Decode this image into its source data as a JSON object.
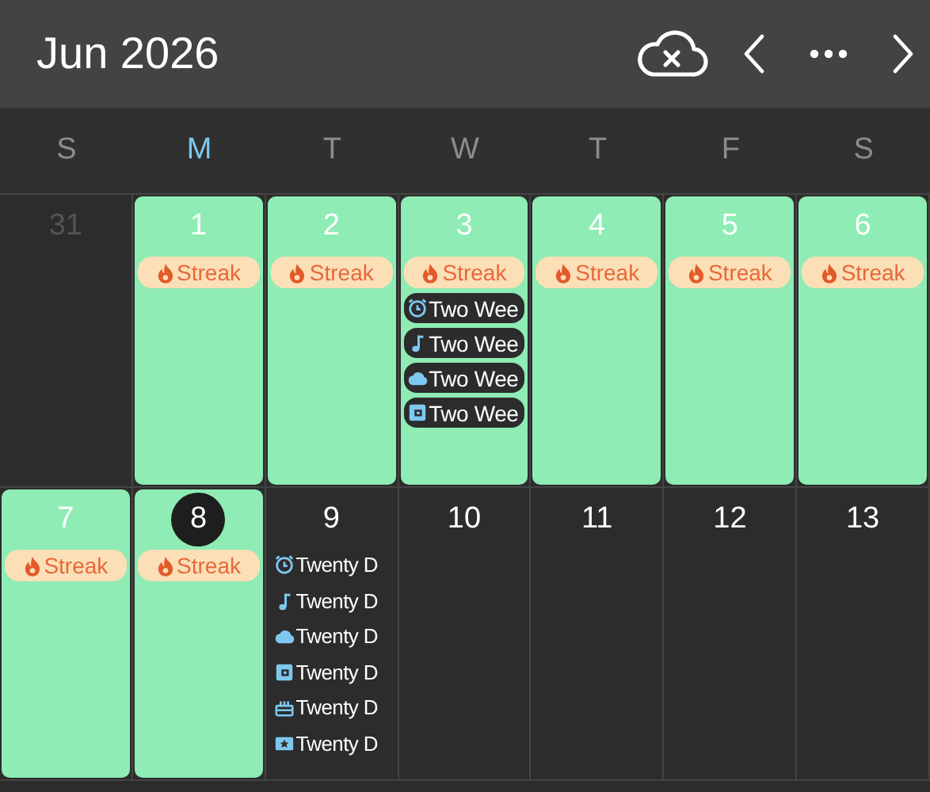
{
  "header": {
    "title": "Jun 2026"
  },
  "weekdays": [
    {
      "label": "S",
      "selected": false
    },
    {
      "label": "M",
      "selected": true
    },
    {
      "label": "T",
      "selected": false
    },
    {
      "label": "W",
      "selected": false
    },
    {
      "label": "T",
      "selected": false
    },
    {
      "label": "F",
      "selected": false
    },
    {
      "label": "S",
      "selected": false
    }
  ],
  "weeks": [
    {
      "days": [
        {
          "number": "31",
          "in_month": false,
          "streak": false,
          "today": false
        },
        {
          "number": "1",
          "in_month": true,
          "streak": true,
          "today": false,
          "events": [
            {
              "kind": "streak",
              "text": "Streak"
            }
          ]
        },
        {
          "number": "2",
          "in_month": true,
          "streak": true,
          "today": false,
          "events": [
            {
              "kind": "streak",
              "text": "Streak"
            }
          ]
        },
        {
          "number": "3",
          "in_month": true,
          "streak": true,
          "today": false,
          "events": [
            {
              "kind": "streak",
              "text": "Streak"
            },
            {
              "kind": "pill",
              "text": "Two Wee"
            },
            {
              "kind": "pill",
              "text": "Two Wee"
            },
            {
              "kind": "pill",
              "text": "Two Wee"
            },
            {
              "kind": "pill",
              "text": "Two Wee"
            }
          ]
        },
        {
          "number": "4",
          "in_month": true,
          "streak": true,
          "today": false,
          "events": [
            {
              "kind": "streak",
              "text": "Streak"
            }
          ]
        },
        {
          "number": "5",
          "in_month": true,
          "streak": true,
          "today": false,
          "events": [
            {
              "kind": "streak",
              "text": "Streak"
            }
          ]
        },
        {
          "number": "6",
          "in_month": true,
          "streak": true,
          "today": false,
          "events": [
            {
              "kind": "streak",
              "text": "Streak"
            }
          ]
        }
      ]
    },
    {
      "days": [
        {
          "number": "7",
          "in_month": true,
          "streak": true,
          "today": false,
          "events": [
            {
              "kind": "streak",
              "text": "Streak"
            }
          ]
        },
        {
          "number": "8",
          "in_month": true,
          "streak": true,
          "today": true,
          "events": [
            {
              "kind": "streak",
              "text": "Streak"
            }
          ]
        },
        {
          "number": "9",
          "in_month": true,
          "streak": false,
          "today": false,
          "events": [
            {
              "kind": "plain",
              "text": "Twenty D"
            },
            {
              "kind": "plain",
              "text": "Twenty D"
            },
            {
              "kind": "plain",
              "text": "Twenty D"
            },
            {
              "kind": "plain",
              "text": "Twenty D"
            },
            {
              "kind": "plain",
              "text": "Twenty D"
            },
            {
              "kind": "plain",
              "text": "Twenty D"
            }
          ]
        },
        {
          "number": "10",
          "in_month": true,
          "streak": false,
          "today": false
        },
        {
          "number": "11",
          "in_month": true,
          "streak": false,
          "today": false
        },
        {
          "number": "12",
          "in_month": true,
          "streak": false,
          "today": false
        },
        {
          "number": "13",
          "in_month": true,
          "streak": false,
          "today": false
        }
      ]
    }
  ]
}
